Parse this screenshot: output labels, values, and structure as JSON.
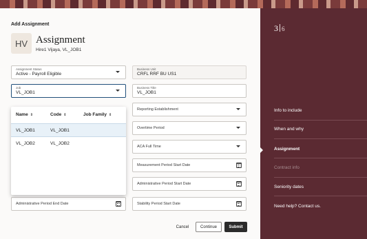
{
  "header": {
    "page_title": "Add Assignment",
    "avatar_initials": "HV",
    "heading": "Assignment",
    "subheading": "Hire1 Vijaya, VL_JOB1"
  },
  "fields": {
    "assignment_status": {
      "label": "Assignment Status",
      "value": "Active - Payroll Eligible"
    },
    "business_unit": {
      "label": "Business Unit",
      "value": "CRFL RRF BU US1"
    },
    "job": {
      "label": "Job",
      "value": "VL_JOB1"
    },
    "business_title": {
      "label": "Business Title",
      "value": "VL_JOB1"
    },
    "reporting_establishment": {
      "placeholder": "Reporting Establishment"
    },
    "overtime_period": {
      "placeholder": "Overtime Period"
    },
    "aca_full_time": {
      "placeholder": "ACA Full Time"
    },
    "measurement_period_start": {
      "placeholder": "Measurement Period Start Date"
    },
    "administrative_period_start": {
      "placeholder": "Administrative Period Start Date"
    },
    "administrative_period_end": {
      "placeholder": "Administrative Period End Date"
    },
    "stability_period_start": {
      "placeholder": "Stability Period Start Date"
    }
  },
  "job_dropdown": {
    "columns": [
      "Name",
      "Code",
      "Job Family"
    ],
    "rows": [
      {
        "name": "VL_JOB1",
        "code": "VL_JOB1",
        "selected": true
      },
      {
        "name": "VL_JOB2",
        "code": "VL_JOB2",
        "selected": false
      }
    ]
  },
  "buttons": {
    "cancel": "Cancel",
    "continue": "Continue",
    "submit": "Submit"
  },
  "sidebar": {
    "step_current": "3",
    "step_total": "6",
    "items": [
      {
        "label": "Info to include",
        "state": "normal"
      },
      {
        "label": "When and why",
        "state": "normal"
      },
      {
        "label": "Assignment",
        "state": "active"
      },
      {
        "label": "Contract info",
        "state": "disabled"
      },
      {
        "label": "Seniority dates",
        "state": "normal"
      },
      {
        "label": "Need help? Contact us.",
        "state": "normal"
      }
    ]
  },
  "colors": {
    "sidebar_bg": "#5b2a32",
    "primary_button": "#2b2b2b",
    "selected_row": "#e8f1f8",
    "focus_border": "#1f4f7a"
  }
}
